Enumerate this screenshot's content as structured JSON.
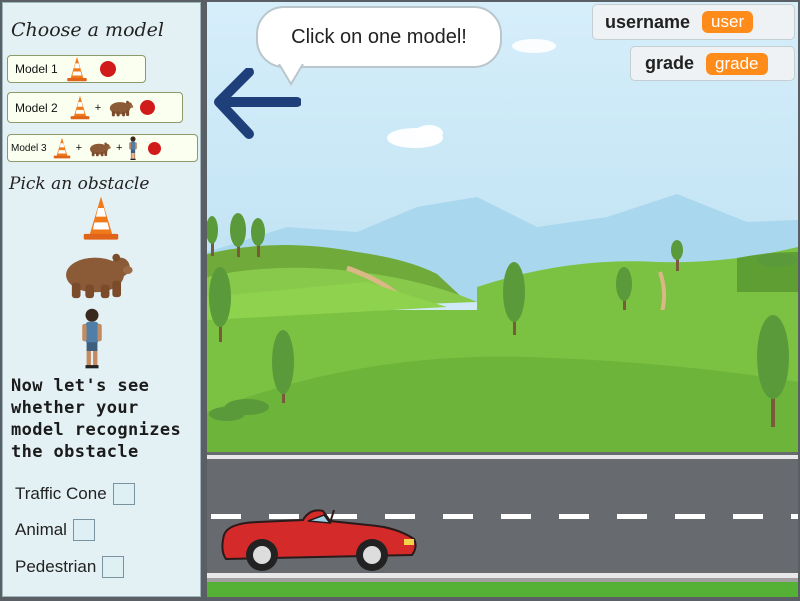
{
  "sidebar": {
    "title": "Choose a model",
    "models": [
      {
        "label": "Model 1"
      },
      {
        "label": "Model 2"
      },
      {
        "label": "Model 3"
      }
    ],
    "pick_title": "Pick an obstacle",
    "prompt": "Now let's see whether your model recognizes the obstacle",
    "checkboxes": [
      {
        "label": "Traffic Cone",
        "checked": false
      },
      {
        "label": "Animal",
        "checked": false
      },
      {
        "label": "Pedestrian",
        "checked": false
      }
    ]
  },
  "stage": {
    "speech": "Click on one model!",
    "variables": [
      {
        "name": "username",
        "value": "user"
      },
      {
        "name": "grade",
        "value": "grade"
      }
    ]
  },
  "icons": [
    "traffic-cone-icon",
    "bear-icon",
    "pedestrian-icon",
    "record-dot-icon",
    "arrow-left-icon",
    "red-car-icon"
  ],
  "colors": {
    "sidebar_bg": "#e4f1f4",
    "variable_value": "#ff8c1a",
    "record_dot": "#d11a1a",
    "arrow": "#1f3f7a",
    "car": "#d42a2a"
  }
}
